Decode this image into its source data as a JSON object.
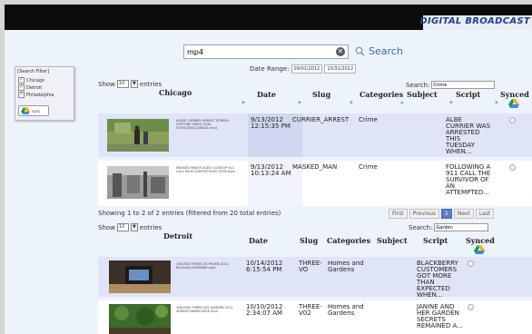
{
  "brand": "DIGITAL BROADCAST",
  "search": {
    "value": "mp4",
    "button_label": "Search"
  },
  "date_range": {
    "label": "Date Range:",
    "from": "09/01/2012",
    "to": "10/31/2012"
  },
  "filter": {
    "title": "[Search Filter]",
    "items": [
      "Chicago",
      "Detroit",
      "Philadelphia"
    ],
    "sync_label": "sync"
  },
  "chicago": {
    "title": "Chicago",
    "show_text": "Show",
    "entries_text": "entries",
    "show_value": "10",
    "search_label": "Search:",
    "search_value": "Crime",
    "headers": {
      "date": "Date",
      "slug": "Slug",
      "categories": "Categories",
      "subject": "Subject",
      "script": "Script",
      "synced": "Synced"
    },
    "rows": [
      {
        "caption": "ALBEE CURRIER ARREST SCREEN CAPTURE VIDEO 1030 5555C0044120EA01.mp4",
        "date": "9/13/2012 12:15:35 PM",
        "slug": "CURRIER_ARREST",
        "category": "Crime",
        "script": "ALBE CURRIER WAS ARRESTED THIS TUESDAY WHEN..."
      },
      {
        "caption": "MASKED MAN PLACED CLOSEUP 911 CALL PAGE A30F5974C4FC1F08.mp4",
        "date": "9/13/2012 10:13:24 AM",
        "slug": "MASKED_MAN",
        "category": "Crime",
        "script": "FOLLOWING A 911 CALL THE SURVIVOR OF AN ATTEMPTED..."
      }
    ],
    "info": "Showing 1 to 2 of 2 entries (filtered from 20 total entries)",
    "pager": [
      "First",
      "Previous",
      "1",
      "Next",
      "Last"
    ]
  },
  "detroit": {
    "title": "Detroit",
    "show_text": "Show",
    "entries_text": "entries",
    "show_value": "10",
    "search_label": "Search:",
    "search_value": "Garden",
    "headers": {
      "date": "Date",
      "slug": "Slug",
      "categories": "Categories",
      "subject": "Subject",
      "script": "Script",
      "synced": "Synced"
    },
    "rows": [
      {
        "caption": "10N END THREE-VO PHONE 2012 BD14AA12E2B5565.mp4",
        "date": "10/14/2012 6:15:54 PM",
        "slug": "THREE-VO",
        "category": "Homes and Gardens",
        "script": "BLACKBERRY CUSTOMERS GOT MORE THAN EXPECTED WHEN..."
      },
      {
        "caption": "10N END THREE-V02 GARDEN 2012 4D5E6F7A8B9C0D1E.mp4",
        "date": "10/10/2012 2:34:07 AM",
        "slug": "THREE-V02",
        "category": "Homes and Gardens",
        "script": "JANINE AND HER GARDEN SECRETS REMAINED A..."
      }
    ]
  }
}
